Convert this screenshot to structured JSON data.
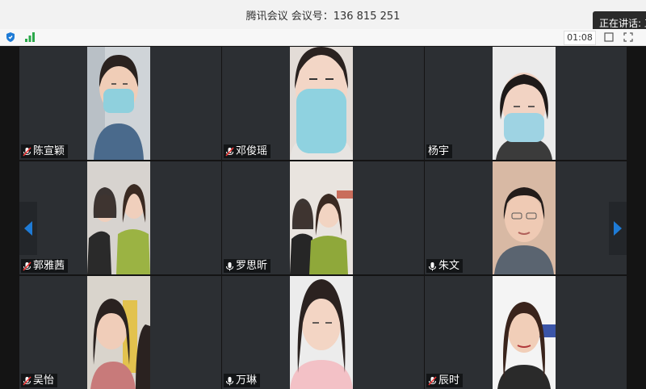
{
  "window": {
    "title": "腾讯会议 会议号：136 815 251"
  },
  "speaking_banner": "正在讲话: 工",
  "toolbar": {
    "timer": "01:08"
  },
  "participants": [
    {
      "name": "陈宣颖",
      "mic": "muted"
    },
    {
      "name": "邓俊瑶",
      "mic": "muted"
    },
    {
      "name": "杨宇",
      "mic": "none"
    },
    {
      "name": "郭雅茜",
      "mic": "muted"
    },
    {
      "name": "罗思昕",
      "mic": "on"
    },
    {
      "name": "朱文",
      "mic": "on"
    },
    {
      "name": "吴怡",
      "mic": "muted"
    },
    {
      "name": "万琳",
      "mic": "on"
    },
    {
      "name": "辰时",
      "mic": "muted"
    }
  ],
  "colors": {
    "accent": "#1e7bd6",
    "signal": "#2ba84a",
    "tile_bg": "#2c2f33"
  }
}
